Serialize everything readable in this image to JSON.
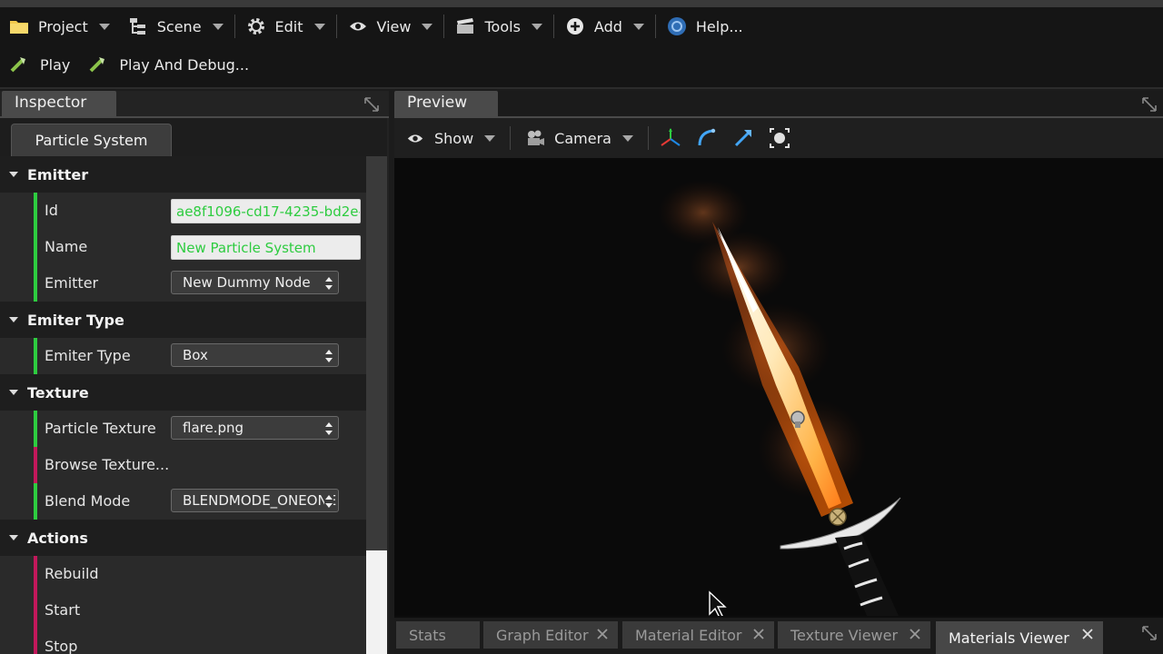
{
  "toolbar": {
    "menus": [
      {
        "label": "Project",
        "icon": "folder-icon"
      },
      {
        "label": "Scene",
        "icon": "hierarchy-icon"
      },
      {
        "label": "Edit",
        "icon": "gear-icon"
      },
      {
        "label": "View",
        "icon": "eye-icon"
      },
      {
        "label": "Tools",
        "icon": "clapper-icon"
      },
      {
        "label": "Add",
        "icon": "plus-circle-icon"
      },
      {
        "label": "Help...",
        "icon": "help-icon"
      }
    ],
    "play_label": "Play",
    "play_debug_label": "Play And Debug..."
  },
  "inspector": {
    "title": "Inspector",
    "tab": "Particle System",
    "sections": {
      "emitter": {
        "title": "Emitter",
        "id_label": "Id",
        "id_value": "ae8f1096-cd17-4235-bd2e-",
        "name_label": "Name",
        "name_value": "New Particle System",
        "emitter_label": "Emitter",
        "emitter_value": "New Dummy Node"
      },
      "emitter_type": {
        "title": "Emiter Type",
        "type_label": "Emiter Type",
        "type_value": "Box"
      },
      "texture": {
        "title": "Texture",
        "particle_texture_label": "Particle Texture",
        "particle_texture_value": "flare.png",
        "browse_label": "Browse Texture...",
        "blend_mode_label": "Blend Mode",
        "blend_mode_value": "BLENDMODE_ONEONE"
      },
      "actions": {
        "title": "Actions",
        "rebuild_label": "Rebuild",
        "start_label": "Start",
        "stop_label": "Stop"
      }
    }
  },
  "preview": {
    "title": "Preview",
    "show_label": "Show",
    "camera_label": "Camera"
  },
  "bottom_tabs": [
    {
      "label": "Stats",
      "active": false
    },
    {
      "label": "Graph Editor",
      "active": false
    },
    {
      "label": "Material Editor",
      "active": false
    },
    {
      "label": "Texture Viewer",
      "active": false
    },
    {
      "label": "Materials Viewer",
      "active": true
    }
  ],
  "colors": {
    "accent_green": "#2ecc40",
    "accent_red": "#c2185b"
  }
}
